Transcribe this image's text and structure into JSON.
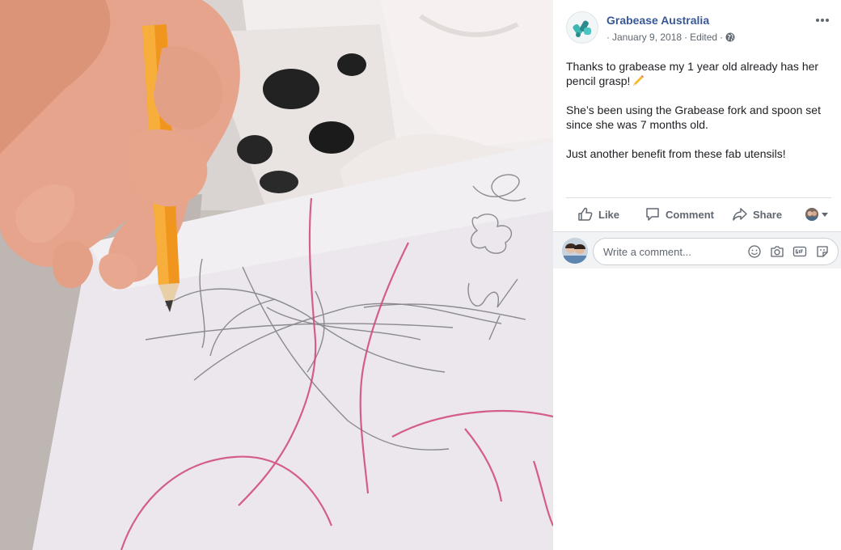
{
  "post": {
    "page_name": "Grabease Australia",
    "meta_prefix": "·",
    "date": "January 9, 2018",
    "separator": "·",
    "edited": "Edited",
    "separator2": "·",
    "paragraphs": [
      "Thanks to grabease my 1 year old already has her pencil grasp!",
      "She’s been using the Grabease fork and spoon set since she was 7 months old.",
      "Just another benefit from these fab utensils!"
    ]
  },
  "actions": {
    "like": "Like",
    "comment": "Comment",
    "share": "Share"
  },
  "comment_box": {
    "placeholder": "Write a comment..."
  },
  "icons": {
    "page_avatar": "grabease-logo-icon",
    "privacy": "globe-icon",
    "more": "more-options-icon",
    "emoji_in_text": "pencil-emoji-icon",
    "like": "thumbs-up-icon",
    "comment": "speech-bubble-icon",
    "share": "share-arrow-icon",
    "comment_icons": [
      "emoji-icon",
      "camera-icon",
      "gif-icon",
      "sticker-icon"
    ]
  },
  "colors": {
    "page_name": "#385898",
    "meta": "#606770",
    "text": "#1c1e21",
    "pencil": "#f0961e"
  }
}
